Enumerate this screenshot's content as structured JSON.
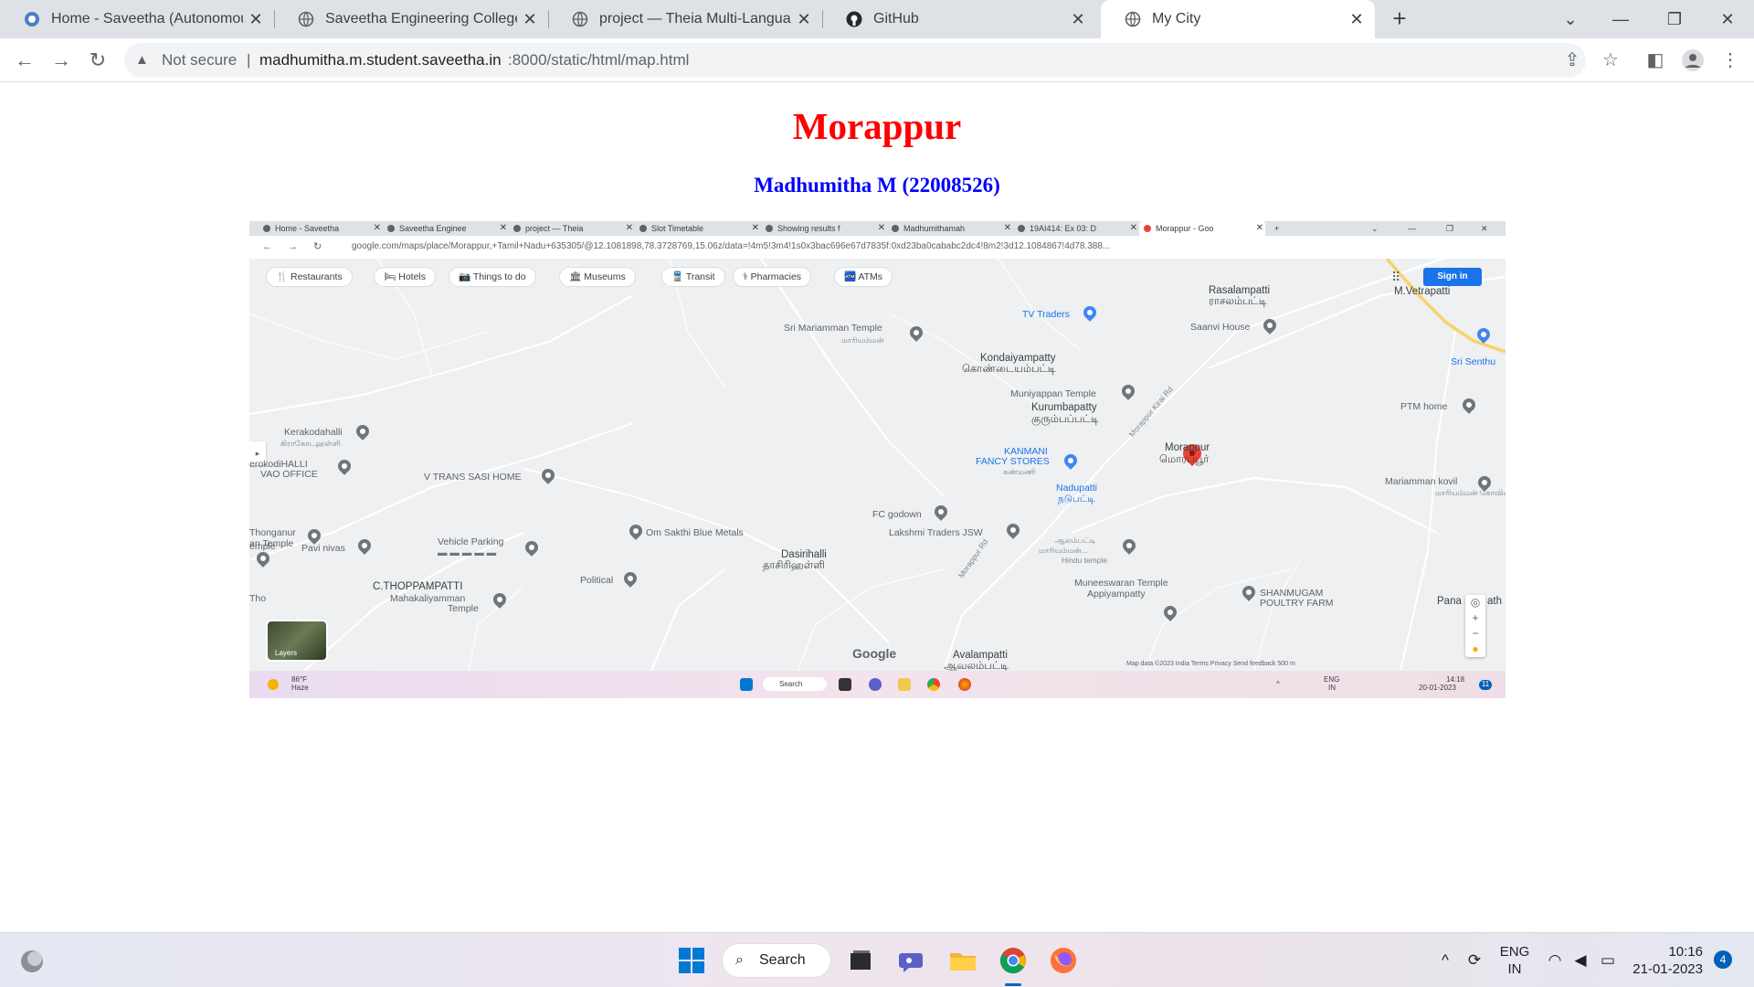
{
  "browser": {
    "tabs": [
      {
        "title": "Home - Saveetha (Autonomous)",
        "active": false
      },
      {
        "title": "Saveetha Engineering College",
        "active": false
      },
      {
        "title": "project — Theia Multi-Language",
        "active": false
      },
      {
        "title": "GitHub",
        "active": false
      },
      {
        "title": "My City",
        "active": true
      }
    ],
    "security_label": "Not secure",
    "url_host": "madhumitha.m.student.saveetha.in",
    "url_path": ":8000/static/html/map.html"
  },
  "page": {
    "title": "Morappur",
    "subtitle": "Madhumitha M (22008526)"
  },
  "embedded_screenshot": {
    "tabs": [
      "Home - Saveetha",
      "Saveetha Enginee",
      "project — Theia",
      "Slot Timetable",
      "Showing results f",
      "Madhumithamah",
      "19AI414: Ex 03: D",
      "Morappur - Goo"
    ],
    "url": "google.com/maps/place/Morappur,+Tamil+Nadu+635305/@12.1081898,78.3728769,15.06z/data=!4m5!3m4!1s0x3bac696e67d7835f:0xd23ba0cababc2dc4!8m2!3d12.1084867!4d78.388...",
    "chips": [
      "Restaurants",
      "Hotels",
      "Things to do",
      "Museums",
      "Transit",
      "Pharmacies",
      "ATMs"
    ],
    "sign_in": "Sign in",
    "labels": {
      "rasalampatti": "Rasalampatti",
      "rasalampatti_ta": "ராசலம்பட்டி",
      "mvetrapatti": "M.Vetrapatti",
      "tv_traders": "TV Traders",
      "saanvi_house": "Saanvi House",
      "sri_senthu": "Sri Senthu",
      "sri_mariamman": "Sri Mariamman Temple",
      "sri_mariamman_ta": "மாரியம்மன்",
      "kondaiyampatty": "Kondaiyampatty",
      "kondaiyampatty_ta": "கொண்டையம்பட்டி",
      "muniyappan": "Muniyappan Temple",
      "kurumbapatty": "Kurumbapatty",
      "kurumbapatty_ta": "குரும்பப்பட்டி",
      "ptm_home": "PTM home",
      "kerakodahalli": "Kerakodahalli",
      "kerakodahalli_ta": "கிராகோடஹள்ளி",
      "kodihalli_vao": "erokodiHALLI",
      "vao_office": "VAO OFFICE",
      "v_trans": "V TRANS SASI HOME",
      "kanmani": "KANMANI",
      "fancy_stores": "FANCY STORES",
      "kanmani_ta": "கண்மணி",
      "morappur": "Morappur",
      "morappur_ta": "மொரப்பூர்",
      "nadupatti": "Nadupatti",
      "nadupatti_ta": "நடுபட்டி",
      "mariamman_kovil": "Mariamman kovil",
      "mariamman_kovil_ta": "மாரியம்மன் கோவில்",
      "fc_godown": "FC godown",
      "thonganur": "Thonganur",
      "thonganur_temple": "an Temple",
      "om_sakthi": "Om Sakthi Blue Metals",
      "lakshmi": "Lakshmi Traders JSW",
      "aalampatti_ta": "ஆலம்பட்டி",
      "mariamman_ta2": "மாரியம்மன்...",
      "hindu_temple": "Hindu temple",
      "temple_left": "emple",
      "pavi_nivas": "Pavi nivas",
      "vehicle_parking": "Vehicle Parking",
      "dasirihalli": "Dasirihalli",
      "dasirihalli_ta": "தாசிரிஹள்ளி",
      "political": "Political",
      "c_thoppampatti": "C.THOPPAMPATTI",
      "mahakaliyamman": "Mahakaliyamman",
      "mahakaliyamman_temple": "Temple",
      "muneeswaran": "Muneeswaran Temple",
      "appiyampatty": "Appiyampatty",
      "shanmugam": "SHANMUGAM",
      "poultry_farm": "POULTRY FARM",
      "pana": "Pana",
      "ath": "ath",
      "avalampatti": "Avalampatti",
      "avalampatti_ta": "ஆவலம்பட்டி",
      "morappur_rd": "Morappur Rd",
      "morappur_ktr_rd": "Morappur Kirai Rd",
      "tho": "Tho"
    },
    "layers_label": "Layers",
    "google_logo": "Google",
    "map_footer": "Map data ©2023     India     Terms     Privacy     Send feedback     500 m",
    "taskbar": {
      "weather_temp": "86°F",
      "weather_desc": "Haze",
      "search": "Search",
      "lang1": "ENG",
      "lang2": "IN",
      "time": "14:18",
      "date": "20-01-2023",
      "notif": "11"
    }
  },
  "taskbar": {
    "search_label": "Search",
    "lang_line1": "ENG",
    "lang_line2": "IN",
    "time": "10:16",
    "date": "21-01-2023",
    "notification_count": "4"
  },
  "colors": {
    "title": "#ff0000",
    "subtitle": "#0000ff",
    "map_pin_red": "#ea4335",
    "signin_blue": "#1a73e8"
  }
}
